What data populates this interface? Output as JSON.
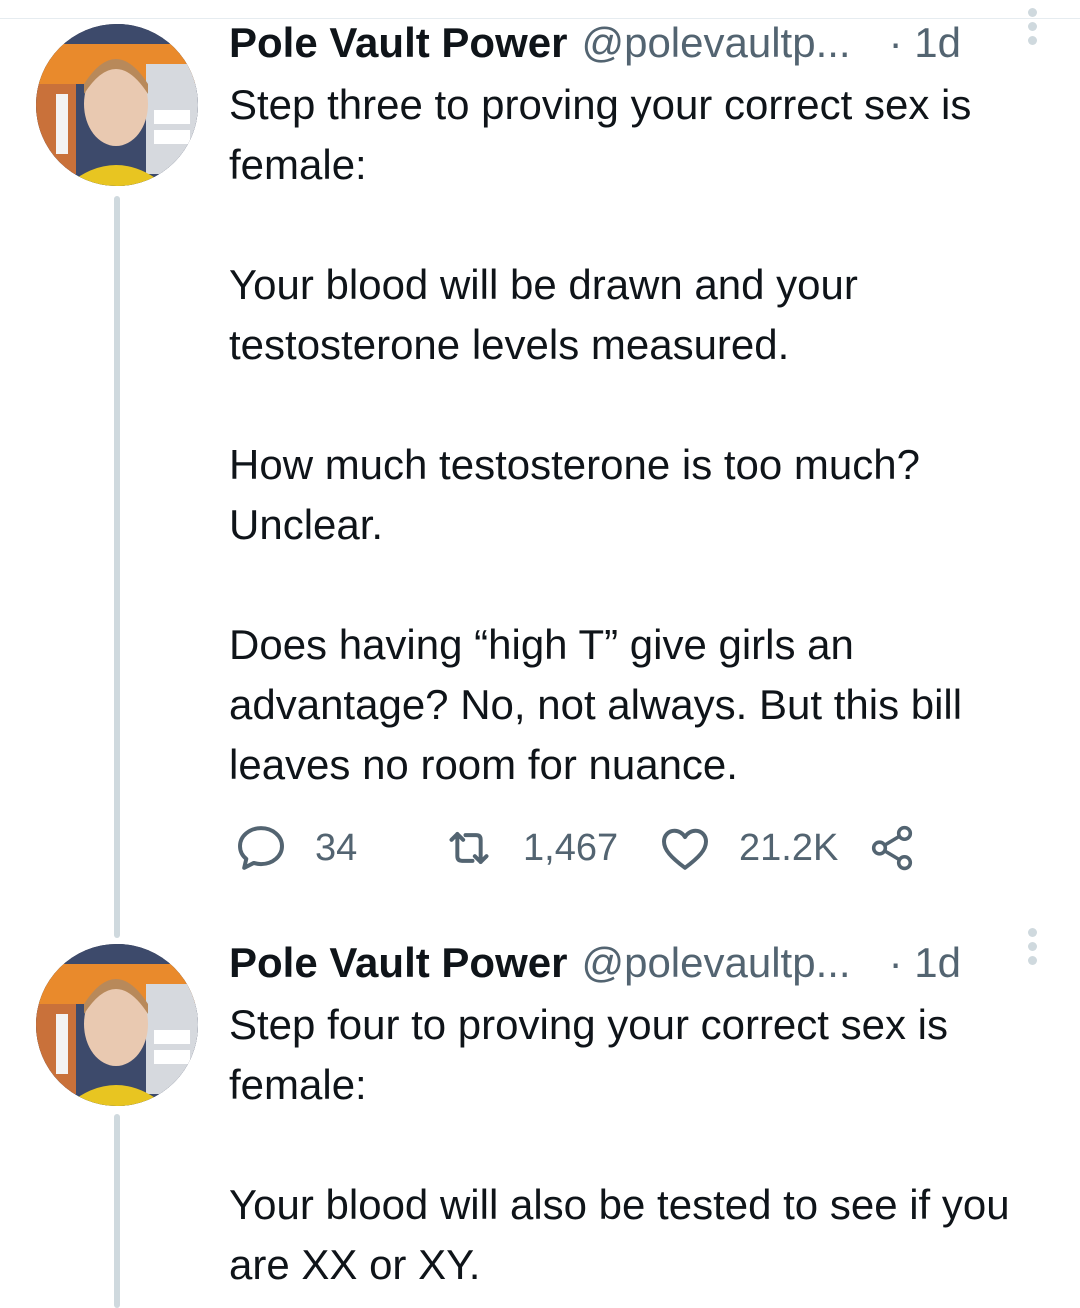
{
  "tweets": [
    {
      "author": {
        "name": "Pole Vault Power",
        "handle": "@polevaultp..."
      },
      "time": "· 1d",
      "paragraphs": [
        "Step three to proving your correct sex is female:",
        "Your blood will be drawn and your testosterone levels measured.",
        "How much testosterone is too much? Unclear.",
        "Does having “high T” give girls an advantage? No, not always. But this bill leaves no room for nuance."
      ],
      "actions": {
        "reply_count": "34",
        "retweet_count": "1,467",
        "like_count": "21.2K"
      }
    },
    {
      "author": {
        "name": "Pole Vault Power",
        "handle": "@polevaultp..."
      },
      "time": "· 1d",
      "paragraphs": [
        "Step four to proving your correct sex is female:",
        "Your blood will also be tested to see if you are XX or XY."
      ]
    }
  ],
  "icons": {
    "reply": "speech-bubble-icon",
    "retweet": "retweet-arrows-icon",
    "like": "heart-icon",
    "share": "share-nodes-icon",
    "more": "vertical-ellipsis-icon"
  },
  "colors": {
    "text": "#0f1419",
    "secondary": "#536471",
    "thread_line": "#cfd9de",
    "divider": "#e6ecf0"
  }
}
